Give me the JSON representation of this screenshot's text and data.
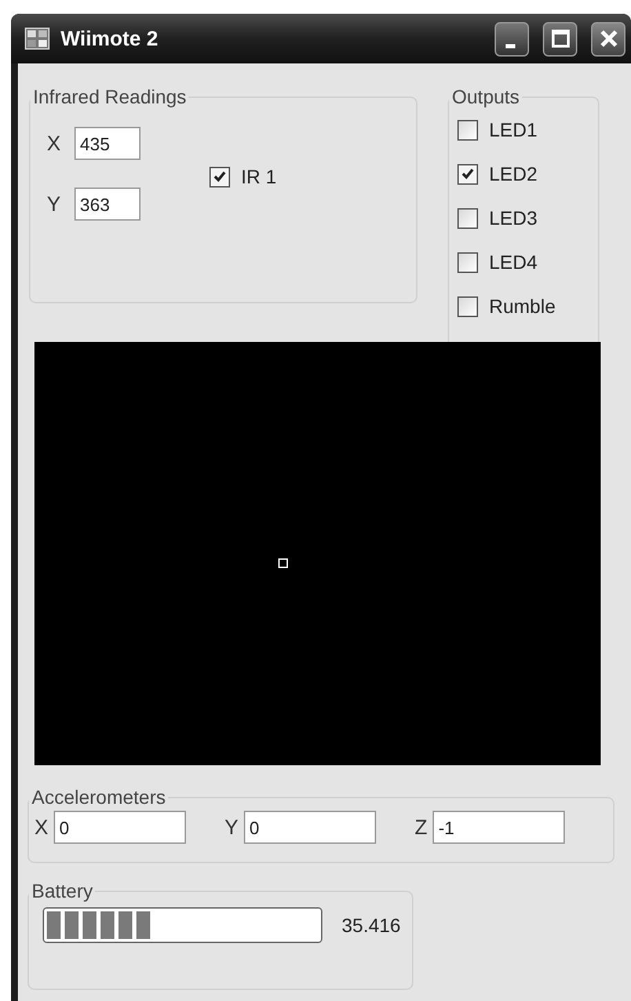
{
  "window": {
    "title": "Wiimote 2"
  },
  "infrared": {
    "title": "Infrared Readings",
    "fields": [
      {
        "label": "X",
        "value": "435"
      },
      {
        "label": "Y",
        "value": "363"
      }
    ],
    "ir_checkbox": {
      "label": "IR 1",
      "checked": true
    }
  },
  "outputs": {
    "title": "Outputs",
    "items": [
      {
        "label": "LED1",
        "checked": false
      },
      {
        "label": "LED2",
        "checked": true
      },
      {
        "label": "LED3",
        "checked": false
      },
      {
        "label": "LED4",
        "checked": false
      },
      {
        "label": "Rumble",
        "checked": false
      }
    ]
  },
  "accelerometers": {
    "title": "Accelerometers",
    "fields": [
      {
        "label": "X",
        "value": "0"
      },
      {
        "label": "Y",
        "value": "0"
      },
      {
        "label": "Z",
        "value": "-1"
      }
    ]
  },
  "battery": {
    "title": "Battery",
    "level": 0.38,
    "reading": "35.416"
  }
}
